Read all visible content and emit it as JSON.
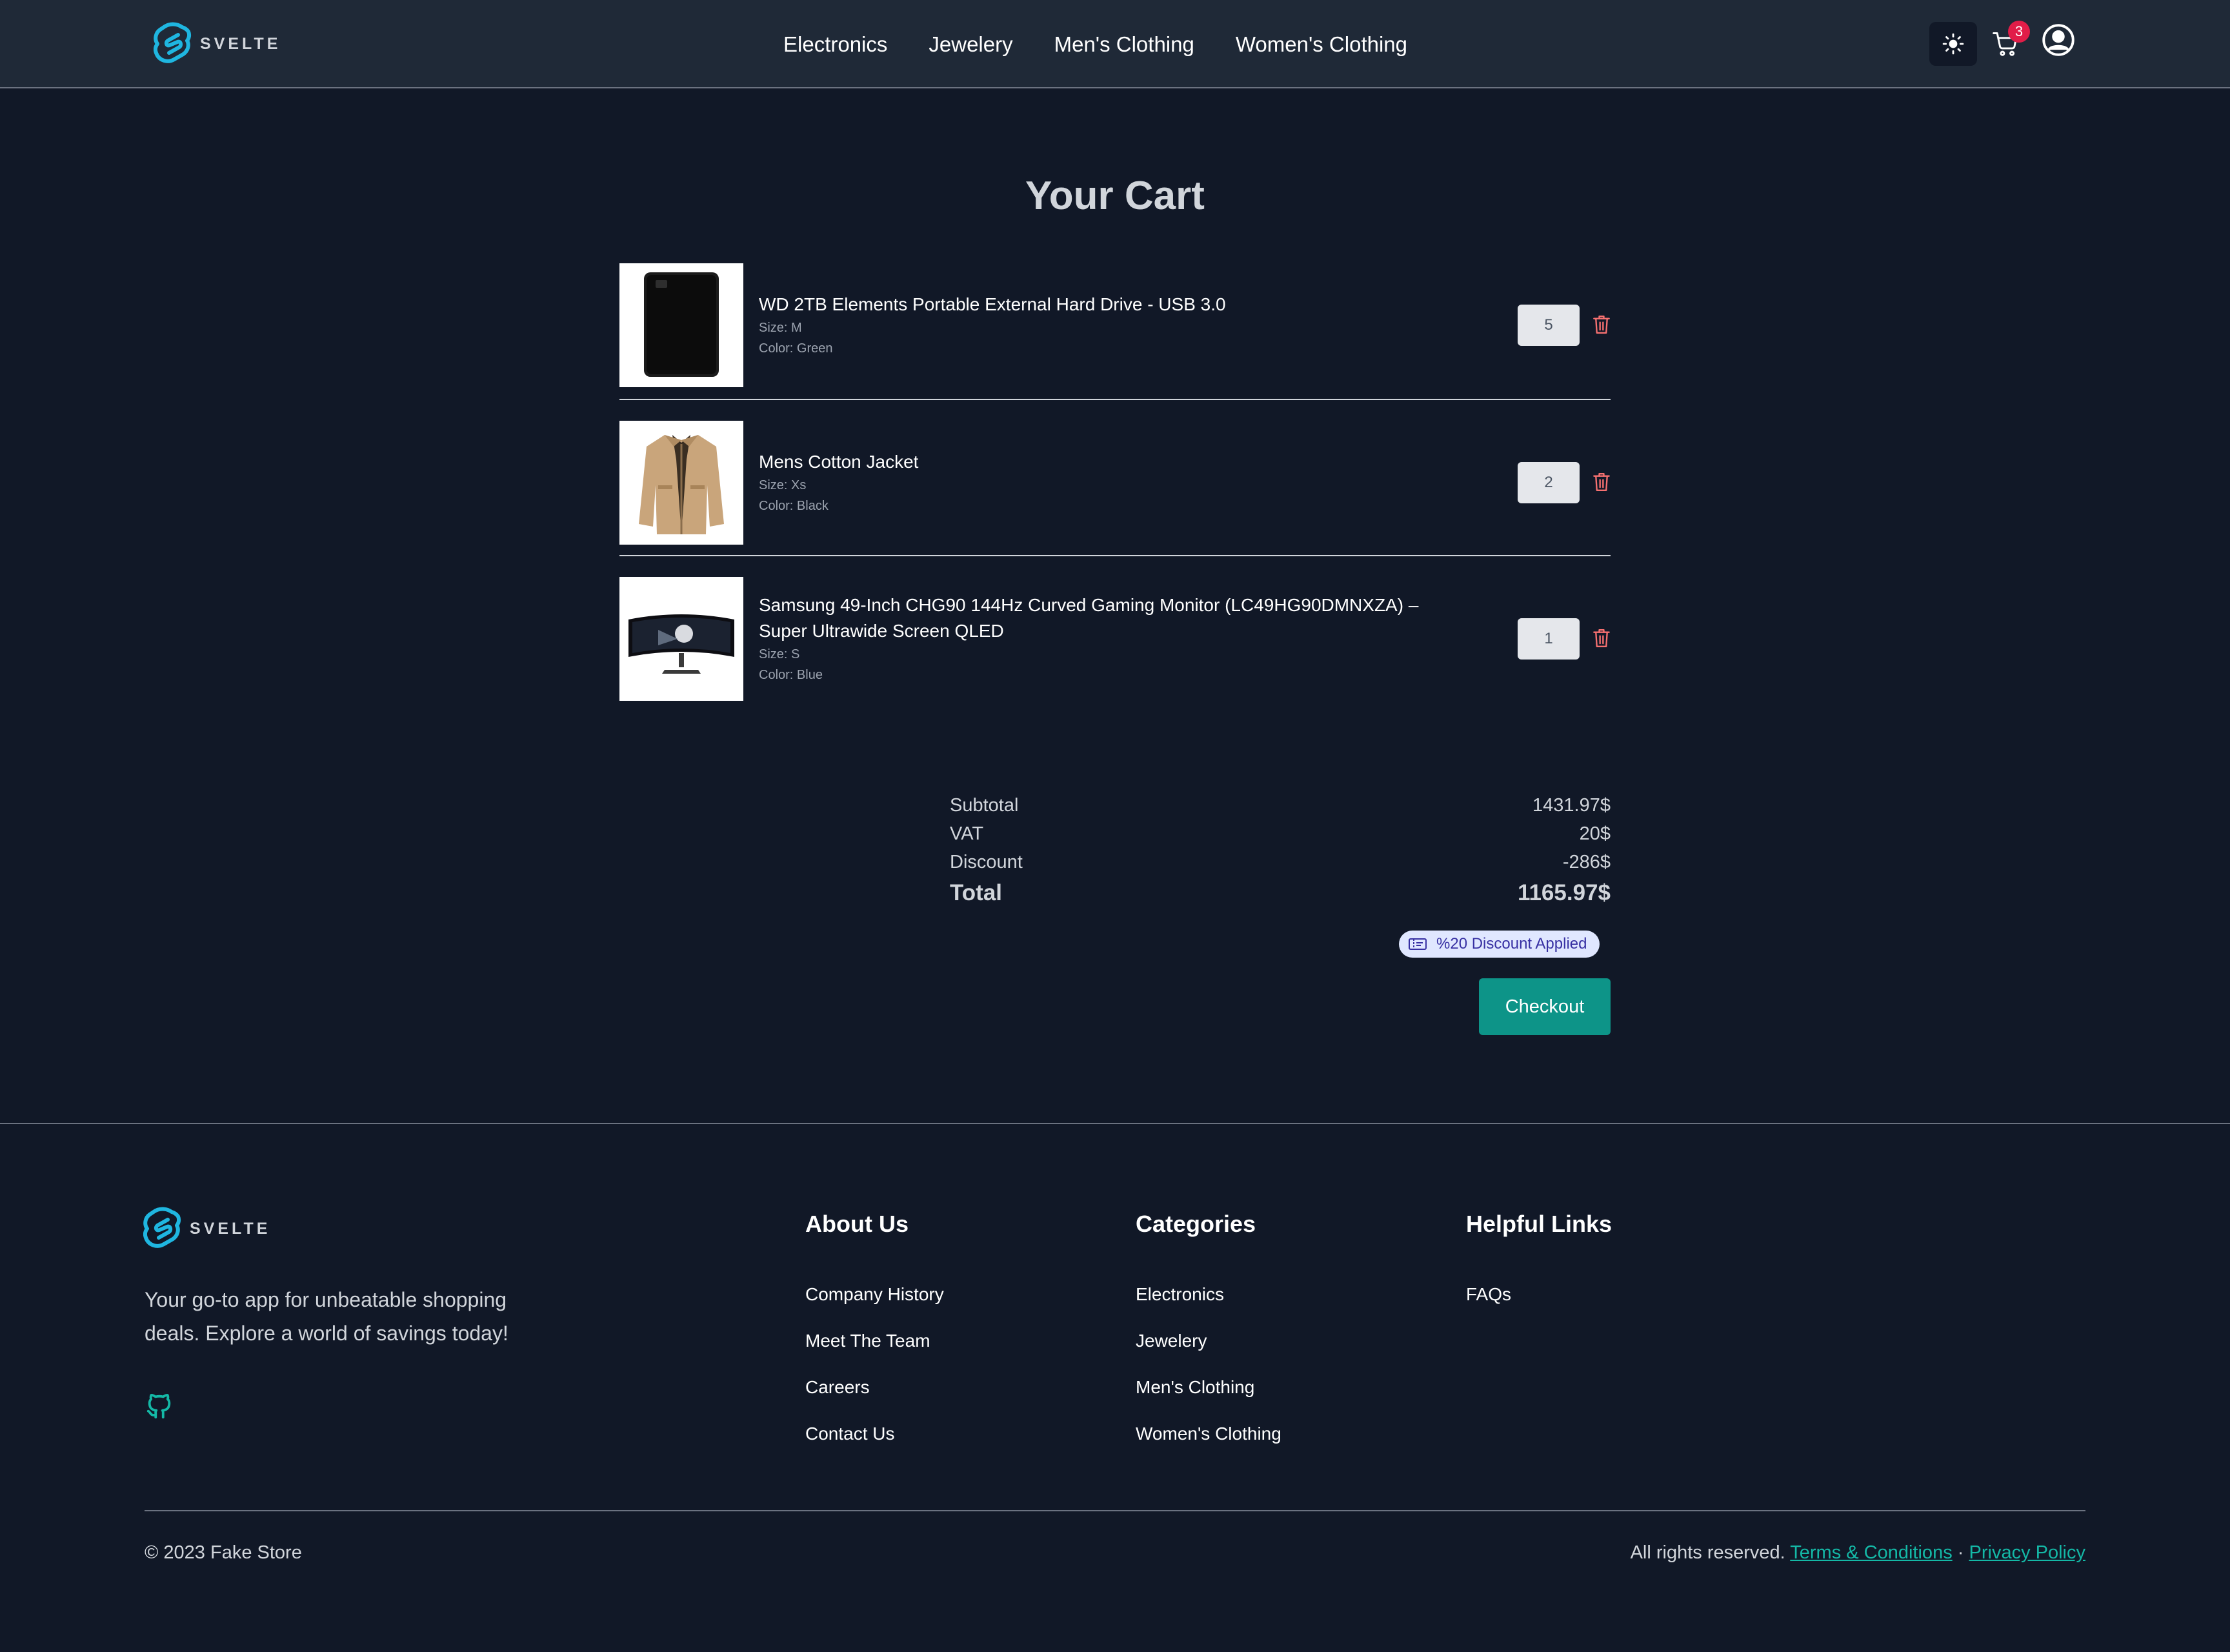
{
  "header": {
    "logo_text": "SVELTE",
    "nav": [
      "Electronics",
      "Jewelery",
      "Men's Clothing",
      "Women's Clothing"
    ],
    "cart_count": "3"
  },
  "main": {
    "title": "Your Cart",
    "items": [
      {
        "name": "WD 2TB Elements Portable External Hard Drive - USB 3.0",
        "size": "Size: M",
        "color": "Color: Green",
        "qty": "5",
        "image": "hard-drive"
      },
      {
        "name": "Mens Cotton Jacket",
        "size": "Size: Xs",
        "color": "Color: Black",
        "qty": "2",
        "image": "jacket"
      },
      {
        "name": "Samsung 49-Inch CHG90 144Hz Curved Gaming Monitor (LC49HG90DMNXZA) – Super Ultrawide Screen QLED",
        "size": "Size: S",
        "color": "Color: Blue",
        "qty": "1",
        "image": "monitor"
      }
    ],
    "summary": {
      "subtotal_label": "Subtotal",
      "subtotal_value": "1431.97$",
      "vat_label": "VAT",
      "vat_value": "20$",
      "discount_label": "Discount",
      "discount_value": "-286$",
      "total_label": "Total",
      "total_value": "1165.97$"
    },
    "discount_badge": "%20 Discount Applied",
    "checkout_label": "Checkout"
  },
  "footer": {
    "logo_text": "SVELTE",
    "tagline": "Your go-to app for unbeatable shopping deals. Explore a world of savings today!",
    "about": {
      "title": "About Us",
      "links": [
        "Company History",
        "Meet The Team",
        "Careers",
        "Contact Us"
      ]
    },
    "categories": {
      "title": "Categories",
      "links": [
        "Electronics",
        "Jewelery",
        "Men's Clothing",
        "Women's Clothing"
      ]
    },
    "helpful": {
      "title": "Helpful Links",
      "links": [
        "FAQs"
      ]
    },
    "copyright": "© 2023 Fake Store",
    "rights": "All rights reserved.",
    "terms": "Terms & Conditions",
    "separator": "·",
    "privacy": "Privacy Policy"
  },
  "colors": {
    "background": "#111827",
    "header_bg": "#1f2937",
    "accent": "#0d9488",
    "badge": "#e11d48",
    "trash": "#f87171",
    "logo": "#1fb6e0"
  }
}
